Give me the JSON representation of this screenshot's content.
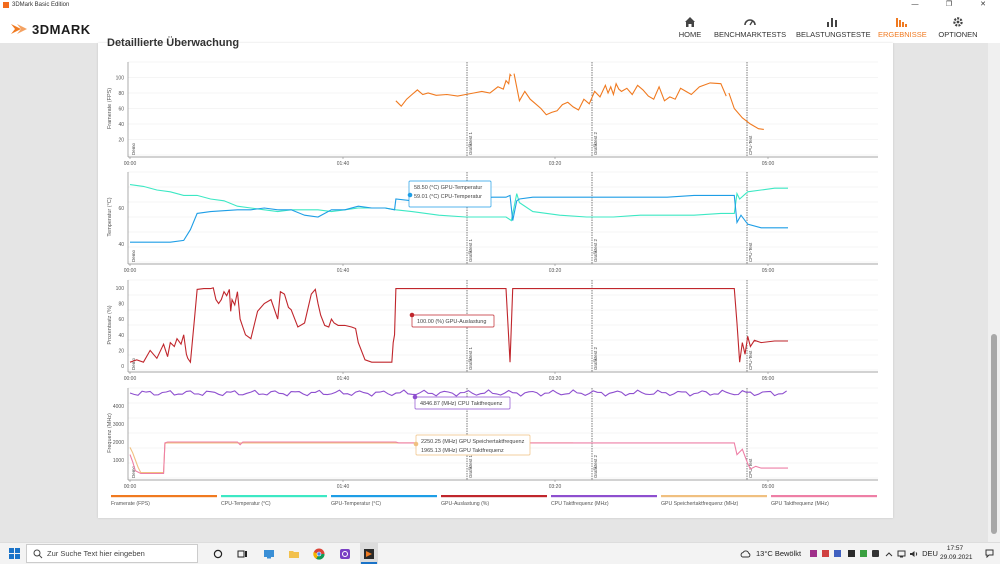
{
  "window": {
    "title": "3DMark Basic Edition",
    "minimize": "—",
    "maximize": "❐",
    "close": "✕"
  },
  "app": {
    "logo": "3DMARK"
  },
  "nav": [
    {
      "label": "HOME",
      "icon": "home-icon"
    },
    {
      "label": "BENCHMARKTESTS",
      "icon": "gauge-icon"
    },
    {
      "label": "BELASTUNGSTESTE",
      "icon": "bars-icon"
    },
    {
      "label": "ERGEBNISSE",
      "icon": "results-icon",
      "active": true
    },
    {
      "label": "OPTIONEN",
      "icon": "gear-icon"
    }
  ],
  "colors": {
    "accent": "#f07a20",
    "fps": "#f07a20",
    "cpu_temp": "#3de8c4",
    "gpu_temp": "#1e9ee6",
    "gpu_load": "#c0262c",
    "cpu_clock": "#8e4fcf",
    "gpu_mem": "#f0c080",
    "gpu_clock": "#ee7fa6"
  },
  "section_title": "Detaillierte Überwachung",
  "time_ticks": [
    "00:00",
    "01:40",
    "03:20",
    "05:00"
  ],
  "phases": [
    "Demo",
    "Grafiktest 1",
    "Grafiktest 2",
    "CPU-Test"
  ],
  "chart_data": [
    {
      "type": "line",
      "ylabel": "Framerate (FPS)",
      "yticks": [
        20,
        40,
        60,
        80,
        100
      ],
      "ylim": [
        0,
        120
      ],
      "xlim": [
        0,
        330
      ],
      "series": [
        {
          "name": "Framerate (FPS)",
          "x": [
            198,
            202,
            206,
            210,
            214,
            218,
            222,
            228,
            236,
            244,
            250,
            256,
            262,
            268,
            274,
            278,
            280,
            282,
            283,
            284,
            286,
            290,
            294,
            298,
            302,
            306,
            310,
            314,
            318,
            322,
            326,
            330,
            334,
            338,
            342,
            346,
            350,
            354,
            356,
            358,
            360,
            362,
            364,
            366,
            370,
            374,
            378,
            382,
            386,
            390,
            394,
            398,
            402,
            406,
            410,
            414,
            418,
            424,
            432,
            440,
            444,
            446,
            450,
            456,
            462,
            468,
            472
          ],
          "y": [
            70,
            63,
            72,
            78,
            84,
            78,
            80,
            77,
            78,
            76,
            78,
            80,
            82,
            80,
            88,
            85,
            96,
            92,
            104,
            102,
            105,
            70,
            82,
            72,
            66,
            60,
            52,
            55,
            57,
            65,
            68,
            62,
            58,
            72,
            66,
            82,
            75,
            90,
            80,
            88,
            78,
            92,
            85,
            82,
            86,
            78,
            90,
            84,
            76,
            72,
            88,
            70,
            75,
            72,
            86,
            82,
            78,
            88,
            93,
            92,
            76,
            80,
            60,
            48,
            40,
            34,
            33
          ]
        }
      ]
    },
    {
      "type": "line",
      "ylabel": "Temperatur (°C)",
      "yticks": [
        40,
        60
      ],
      "ylim": [
        30,
        80
      ],
      "xlim": [
        0,
        330
      ],
      "series": [
        {
          "name": "CPU-Temperatur (°C)",
          "x": [
            0,
            10,
            20,
            30,
            40,
            50,
            60,
            70,
            80,
            90,
            100,
            110,
            120,
            130,
            140,
            150,
            160,
            170,
            180,
            190,
            198,
            210,
            230,
            250,
            270,
            280,
            284,
            288,
            290,
            300,
            320,
            340,
            360,
            380,
            400,
            420,
            440,
            450,
            452,
            454,
            460,
            470,
            480,
            490
          ],
          "y": [
            73,
            72,
            70,
            69,
            67,
            67,
            65,
            64,
            61,
            60,
            59,
            58,
            59,
            59,
            59,
            58,
            59,
            60,
            60,
            60,
            59,
            58,
            56,
            55,
            55,
            55,
            53,
            68,
            63,
            58,
            56,
            55,
            55,
            56,
            56,
            56,
            57,
            57,
            68,
            65,
            69,
            70,
            71,
            71
          ]
        },
        {
          "name": "GPU-Temperatur (°C)",
          "x": [
            0,
            20,
            30,
            40,
            45,
            50,
            60,
            80,
            90,
            100,
            110,
            120,
            130,
            140,
            150,
            160,
            170,
            180,
            190,
            197,
            198,
            210,
            230,
            250,
            270,
            280,
            283,
            285,
            288,
            290,
            300,
            320,
            340,
            360,
            380,
            400,
            420,
            440,
            450,
            452,
            455,
            460,
            470,
            490
          ],
          "y": [
            41,
            41,
            41,
            42,
            48,
            57,
            58,
            59,
            59,
            60,
            59,
            59,
            56,
            55,
            59,
            59,
            61,
            60,
            60,
            59,
            65,
            64,
            65,
            65,
            66,
            66,
            67,
            53,
            64,
            65,
            66,
            66,
            66,
            66,
            66,
            66,
            67,
            67,
            67,
            52,
            56,
            51,
            49,
            49
          ]
        }
      ]
    },
    {
      "type": "line",
      "ylabel": "Prozentsatz (%)",
      "yticks": [
        0,
        20,
        40,
        60,
        80,
        100
      ],
      "ylim": [
        -5,
        110
      ],
      "xlim": [
        0,
        330
      ],
      "series": [
        {
          "name": "GPU-Auslastung (%)",
          "x": [
            0,
            5,
            10,
            15,
            20,
            25,
            28,
            30,
            33,
            35,
            38,
            40,
            42,
            43,
            45,
            48,
            50,
            55,
            60,
            62,
            64,
            66,
            68,
            70,
            72,
            74,
            75,
            76,
            78,
            80,
            82,
            84,
            86,
            90,
            95,
            100,
            105,
            110,
            112,
            115,
            118,
            120,
            125,
            130,
            135,
            138,
            140,
            142,
            145,
            148,
            150,
            152,
            155,
            160,
            165,
            168,
            170,
            175,
            180,
            185,
            190,
            195,
            196,
            197,
            198,
            200,
            210,
            230,
            250,
            270,
            280,
            283,
            285,
            287,
            290,
            300,
            320,
            340,
            360,
            380,
            400,
            420,
            440,
            450,
            452,
            454,
            456,
            458,
            460,
            462,
            465,
            470,
            480,
            490
          ],
          "y": [
            5,
            8,
            5,
            20,
            10,
            28,
            12,
            30,
            25,
            35,
            28,
            40,
            15,
            10,
            5,
            60,
            98,
            99,
            99,
            100,
            85,
            80,
            85,
            95,
            90,
            98,
            70,
            85,
            78,
            95,
            60,
            50,
            40,
            35,
            70,
            80,
            85,
            60,
            95,
            92,
            75,
            72,
            50,
            55,
            92,
            98,
            80,
            65,
            52,
            50,
            60,
            55,
            52,
            52,
            50,
            48,
            30,
            8,
            5,
            5,
            5,
            5,
            30,
            40,
            99,
            99,
            99,
            99,
            99,
            99,
            99,
            5,
            99,
            99,
            99,
            99,
            99,
            99,
            99,
            99,
            99,
            99,
            99,
            99,
            55,
            5,
            30,
            15,
            38,
            25,
            33,
            30,
            32,
            32
          ]
        }
      ]
    },
    {
      "type": "line",
      "ylabel": "Frequenz (MHz)",
      "yticks": [
        1000,
        2000,
        3000,
        4000
      ],
      "ylim": [
        0,
        5000
      ],
      "xlim": [
        0,
        330
      ],
      "series": [
        {
          "name": "CPU Taktfrequenz (MHz)",
          "values_note": "Oscillating about 4600–4850",
          "x": [
            0,
            330
          ],
          "y": [
            4700,
            4700
          ]
        },
        {
          "name": "GPU Speichertaktfrequenz (MHz)",
          "x": [
            0,
            2,
            4,
            6,
            8,
            25,
            26,
            27,
            28,
            30,
            32,
            34,
            36,
            38,
            40,
            42,
            44,
            46,
            48,
            50,
            52,
            54,
            58,
            60,
            62,
            64,
            66,
            68,
            70,
            72,
            74,
            76,
            78,
            80,
            82,
            84,
            86,
            88,
            90,
            92,
            94,
            96,
            98,
            100,
            102,
            104,
            106,
            108,
            110,
            112,
            114,
            116,
            118,
            120,
            122,
            124,
            126,
            128,
            130,
            132,
            134,
            136,
            138,
            140,
            142,
            144,
            146,
            148,
            150,
            152,
            154,
            156,
            158,
            160,
            162,
            164,
            166,
            168,
            170,
            172,
            174,
            176,
            178,
            180,
            182,
            184,
            186,
            188,
            190,
            192,
            194,
            196,
            198,
            200,
            202,
            204,
            206,
            208,
            210,
            212,
            214,
            216,
            218,
            220,
            222,
            224,
            226,
            228,
            230,
            232,
            234,
            236,
            238,
            240,
            242,
            244,
            246,
            248,
            250,
            252,
            254,
            256,
            258,
            260,
            262,
            264,
            266,
            268,
            270,
            272,
            274,
            276,
            278,
            280,
            282,
            284,
            286,
            288,
            290,
            292,
            294,
            296,
            298,
            300,
            302,
            304,
            306,
            308,
            310,
            312,
            314,
            316,
            318,
            320,
            322,
            324,
            326,
            328,
            330
          ],
          "y": [
            1700,
            1400,
            1000,
            600,
            300,
            300,
            1900,
            1950,
            1950,
            1950,
            1950,
            1950,
            1950,
            1950,
            1950,
            1950,
            1950,
            1950,
            1950,
            1950,
            1950,
            1950,
            1950,
            1950,
            1950,
            1950,
            1950,
            1950,
            1950,
            1950,
            1950,
            1950,
            1950,
            1950,
            1950,
            1950,
            1950,
            1950,
            1950,
            1950,
            1950,
            1950,
            1950,
            1950,
            1950,
            1950,
            1950,
            1950,
            1950,
            1950,
            1950,
            1950,
            1950,
            1950,
            1950,
            1950,
            1950,
            1950,
            1950,
            1950,
            1950,
            1950,
            1950,
            1950,
            1950,
            1950,
            1950,
            1950,
            1950,
            1950,
            1950,
            1950,
            1950,
            1950,
            1950,
            1950,
            1950,
            1950,
            1950,
            1950,
            1950,
            1950,
            1950,
            1950,
            1950,
            1950,
            1950,
            1950,
            1950,
            1950,
            1950,
            1950,
            1950,
            1950,
            1950,
            1950,
            1950,
            1950,
            1950,
            1950,
            1950,
            1950,
            1950,
            1950,
            1950,
            1950,
            1950,
            1950,
            1950,
            1950,
            1950,
            1950,
            1950,
            1950,
            1950,
            1950,
            1950,
            1950,
            1950,
            1950,
            1950,
            1950,
            1950,
            1950,
            1950,
            1950,
            1950,
            1950,
            1950,
            1950,
            1950,
            1950,
            1950,
            1950,
            1950,
            1950,
            1950,
            1950,
            1950,
            1950,
            1950,
            1950,
            1950,
            1950,
            1950,
            1950,
            1950,
            1950,
            1950,
            1950,
            1950,
            1950,
            1950,
            1950,
            1950,
            1950,
            1950,
            1950,
            1950
          ]
        },
        {
          "name": "GPU Taktfrequenz (MHz)",
          "x": [
            0,
            2,
            4,
            8,
            25,
            26,
            28,
            80,
            82,
            84,
            198,
            200,
            280,
            284,
            290,
            440,
            450,
            452,
            456,
            460,
            462,
            466,
            470,
            490
          ],
          "y": [
            1300,
            900,
            400,
            250,
            250,
            1950,
            2000,
            2000,
            1850,
            2000,
            2000,
            1950,
            1950,
            1950,
            1950,
            1950,
            1950,
            1300,
            1600,
            800,
            500,
            650,
            550,
            550
          ]
        }
      ]
    }
  ],
  "tooltips": [
    {
      "lines": [
        "58.50 (°C) GPU-Temperatur",
        "59.01 (°C) CPU-Temperatur"
      ]
    },
    {
      "lines": [
        "100.00 (%) GPU-Auslastung"
      ]
    },
    {
      "lines": [
        "4846.87 (MHz) CPU Taktfrequenz"
      ]
    },
    {
      "lines": [
        "2250.25 (MHz) GPU Speichertaktfrequenz",
        "1965.13 (MHz) GPU Taktfrequenz"
      ]
    }
  ],
  "legend": [
    {
      "label": "Framerate (FPS)",
      "color": "#f07a20"
    },
    {
      "label": "CPU-Temperatur (°C)",
      "color": "#3de8c4"
    },
    {
      "label": "GPU-Temperatur (°C)",
      "color": "#1e9ee6"
    },
    {
      "label": "GPU-Auslastung (%)",
      "color": "#c0262c"
    },
    {
      "label": "CPU Taktfrequenz (MHz)",
      "color": "#8e4fcf"
    },
    {
      "label": "GPU Speichertaktfrequenz (MHz)",
      "color": "#f0c080"
    },
    {
      "label": "GPU Taktfrequenz (MHz)",
      "color": "#ee7fa6"
    }
  ],
  "taskbar": {
    "search_placeholder": "Zur Suche Text hier eingeben",
    "weather": "13°C  Bewölkt",
    "language": "DEU",
    "time": "17:57",
    "date": "29.09.2021"
  }
}
